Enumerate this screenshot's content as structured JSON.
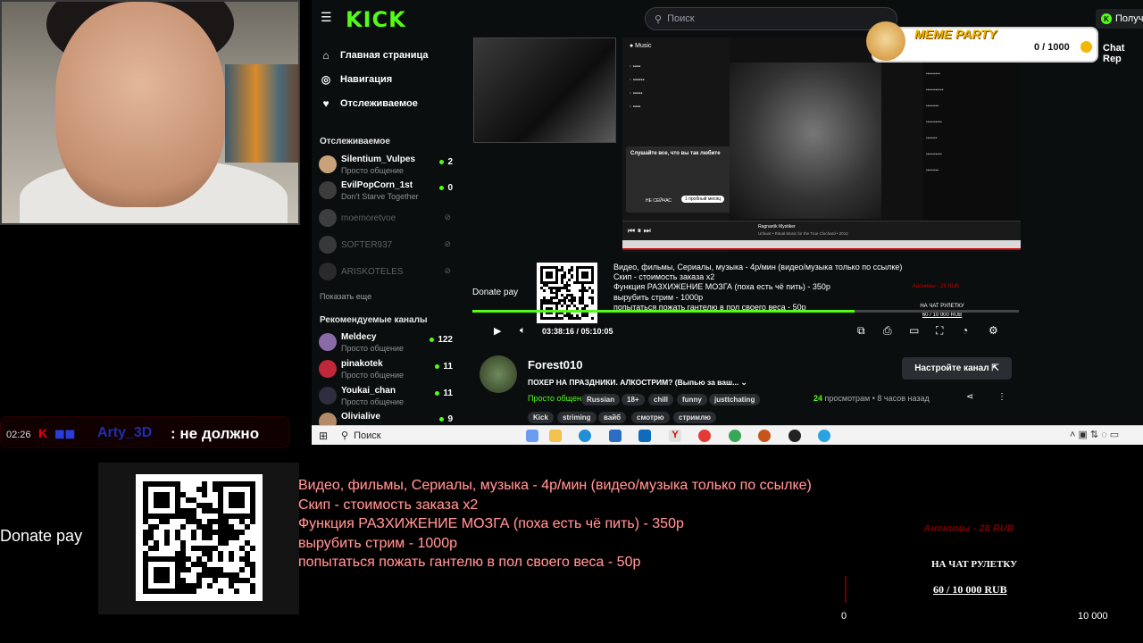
{
  "kick": {
    "logo": "KICK",
    "search_placeholder": "Поиск",
    "login_label": "Получи"
  },
  "sidebar": {
    "nav": [
      {
        "icon": "home-icon",
        "label": "Главная страница"
      },
      {
        "icon": "compass-icon",
        "label": "Навигация"
      },
      {
        "icon": "heart-icon",
        "label": "Отслеживаемое"
      }
    ],
    "followed_title": "Отслеживаемое",
    "followed": [
      {
        "name": "Silentium_Vulpes",
        "sub": "Просто общение",
        "count": "2",
        "live": true
      },
      {
        "name": "EvilPopCorn_1st",
        "sub": "Don't Starve Together",
        "count": "0",
        "live": true
      },
      {
        "name": "moemoretvoe",
        "sub": "",
        "count": "",
        "live": false
      },
      {
        "name": "SOFTER937",
        "sub": "",
        "count": "",
        "live": false
      },
      {
        "name": "ARISKOTELES",
        "sub": "",
        "count": "",
        "live": false
      }
    ],
    "show_more": "Показать еще",
    "recommended_title": "Рекомендуемые каналы",
    "recommended": [
      {
        "name": "Meldecy",
        "sub": "Просто общение",
        "count": "122"
      },
      {
        "name": "pinakotek",
        "sub": "Просто общение",
        "count": "11"
      },
      {
        "name": "Youkai_chan",
        "sub": "Просто общение",
        "count": "11"
      },
      {
        "name": "Olivialive",
        "sub": "",
        "count": "9"
      }
    ]
  },
  "player": {
    "overlay_donate": "Donate pay",
    "overlay_lines": "Видео, фильмы, Сериалы, музыка - 4р/мин (видео/музыка только по ссылке)\nСкип - стоимость заказа x2\nФункция РАЗХИЖЕНИЕ МОЗГА (поха есть чё пить) - 350р\nвырубить стрим - 1000р\nпопытаться пожать гантелю в пол своего веса - 50р",
    "overlay_red": "Анонимы - 28 RUB",
    "overlay_roulette_title": "НА ЧАТ РУЛЕТКУ",
    "overlay_roulette_value": "60 / 10 000 RUB",
    "progress": 0.7,
    "time": "03:38:16 / 05:10:05",
    "ym_track": "Ragnarök Mystiker",
    "ym_artist": "Urfaust • Ritual Music for the True Clochard • 2012",
    "ym_popup_title": "Слушайте все, что вы так любите",
    "ym_popup_btn_no": "НЕ СЕЙЧАС",
    "ym_popup_btn_yes": "1 пробный месяц"
  },
  "stream": {
    "streamer": "Forest010",
    "title": "ПОХЕР НА ПРАЗДНИКИ. АЛКОСТРИМ? (Выпью за ваш...",
    "category": "Просто общение",
    "tags_row1": [
      "Russian",
      "18+",
      "chill",
      "funny",
      "justtchating"
    ],
    "tags_row2": [
      "Kick",
      "striming",
      "вайб",
      "смотрю",
      "стримлю"
    ],
    "setup_button": "Настройте канал",
    "views_count": "24",
    "views_text": "просмотрам",
    "ago": "8 часов назад"
  },
  "meme_party": {
    "title": "MEME PARTY",
    "score": "0 / 1000"
  },
  "chat_rep": "Chat Rep",
  "taskbar": {
    "search": "Поиск"
  },
  "chat": {
    "time": "02:26",
    "user": "Arty_3D",
    "message": ": не должно"
  },
  "bottom": {
    "donate": "Donate pay",
    "lines": "Видео, фильмы, Сериалы, музыка - 4р/мин (видео/музыка только по ссылке)\nСкип - стоимость заказа x2\nФункция РАЗХИЖЕНИЕ МОЗГА (поха есть чё пить) - 350р\nвырубить стрим - 1000р\nпопытаться пожать гантелю в пол своего веса - 50р",
    "red": "Анонимы - 28 RUB",
    "roulette_title": "НА ЧАТ РУЛЕТКУ",
    "roulette_value": "60 / 10 000 RUB",
    "scale_min": "0",
    "scale_max": "10 000"
  }
}
